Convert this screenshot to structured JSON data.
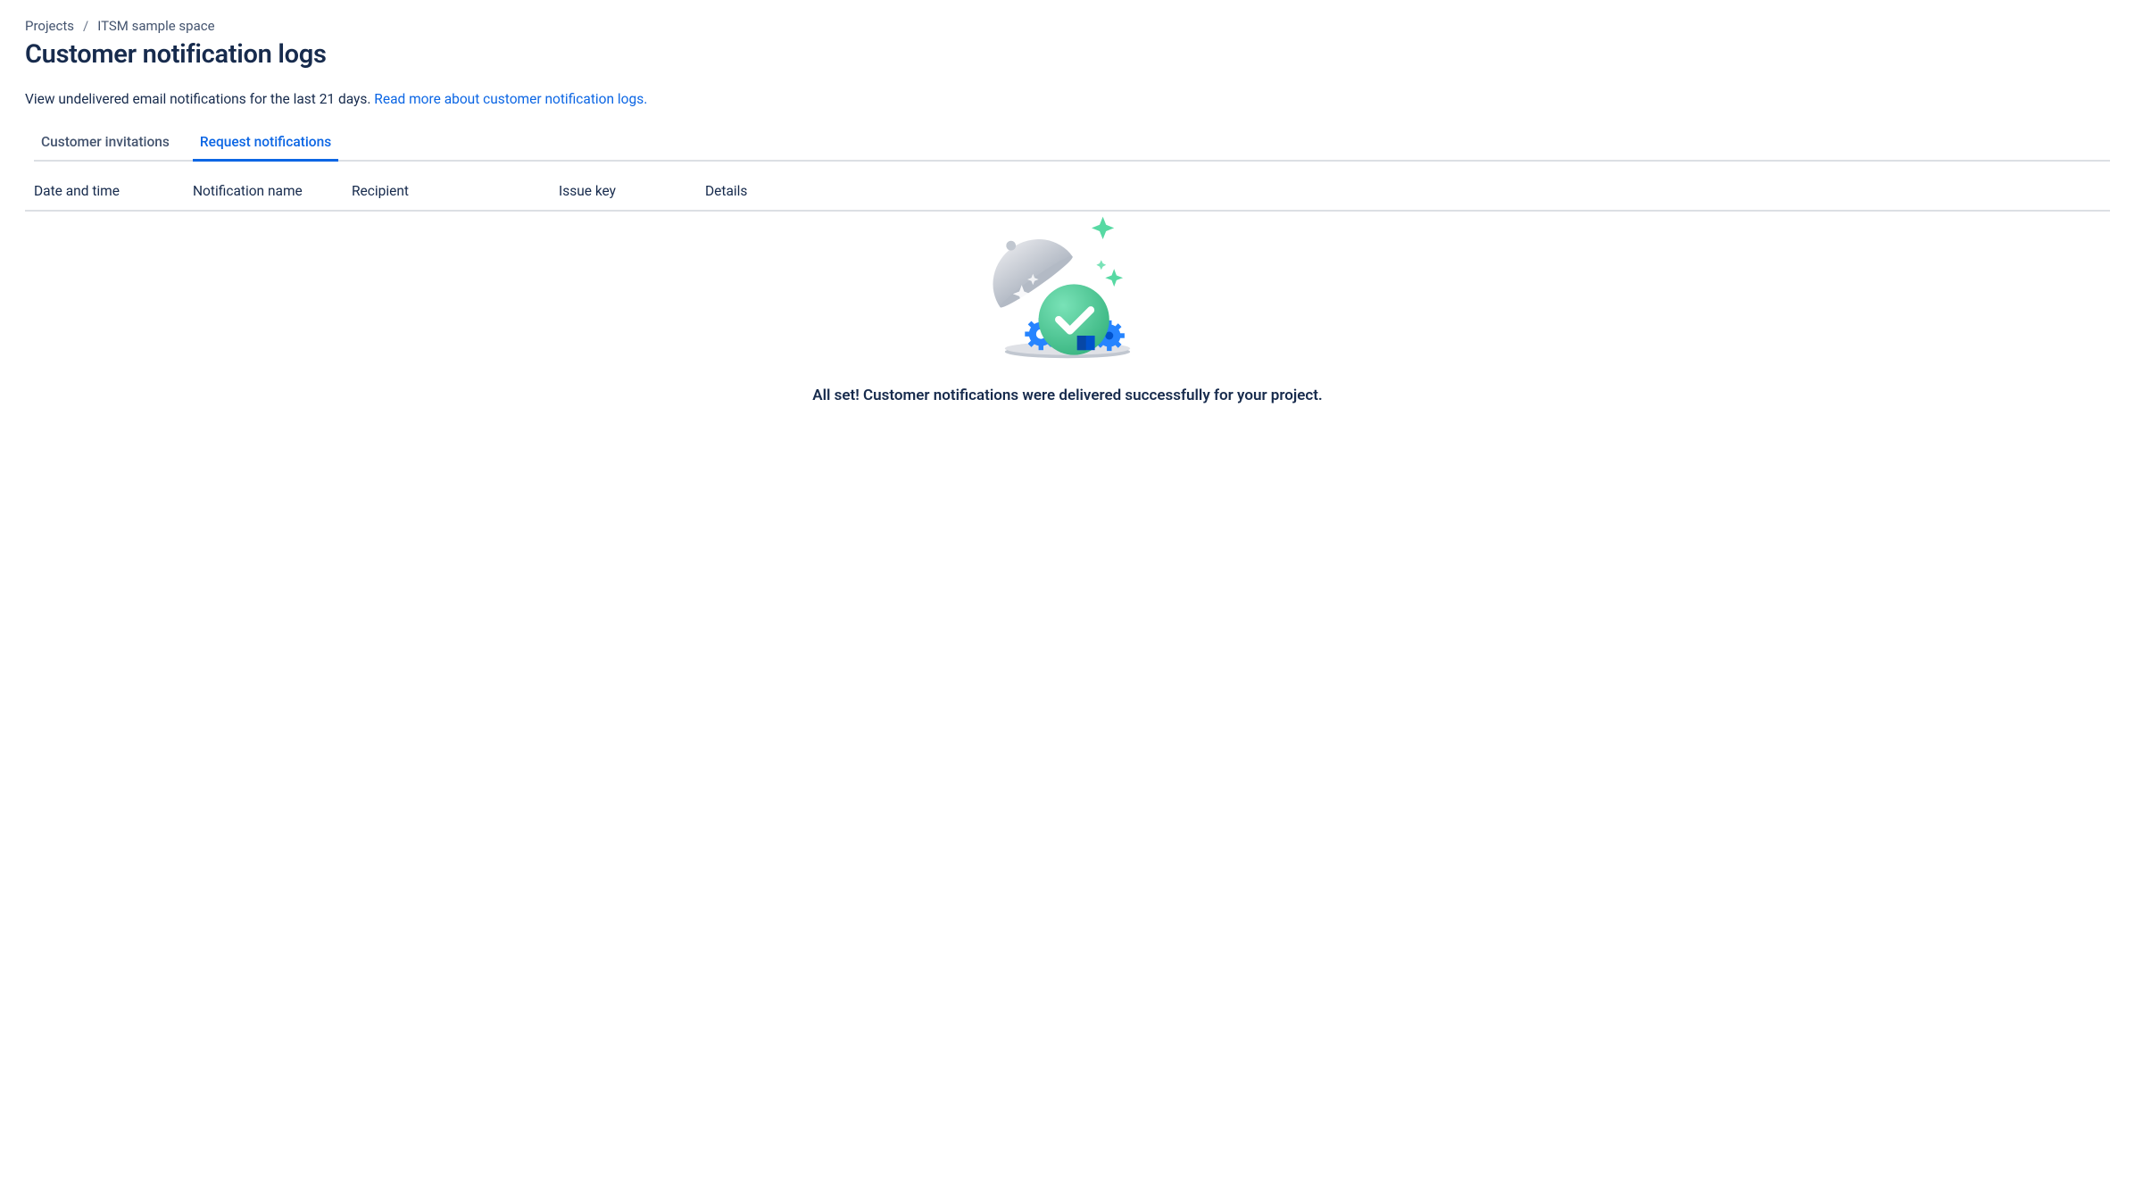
{
  "breadcrumb": {
    "root": "Projects",
    "project": "ITSM sample space"
  },
  "header": {
    "title": "Customer notification logs"
  },
  "description": {
    "text": "View undelivered email notifications for the last 21 days. ",
    "link": "Read more about customer notification logs."
  },
  "tabs": [
    {
      "label": "Customer invitations",
      "active": false
    },
    {
      "label": "Request notifications",
      "active": true
    }
  ],
  "table": {
    "columns": {
      "date": "Date and time",
      "name": "Notification name",
      "recipient": "Recipient",
      "issue": "Issue key",
      "details": "Details"
    }
  },
  "empty_state": {
    "message": "All set! Customer notifications were delivered successfully for your project."
  }
}
